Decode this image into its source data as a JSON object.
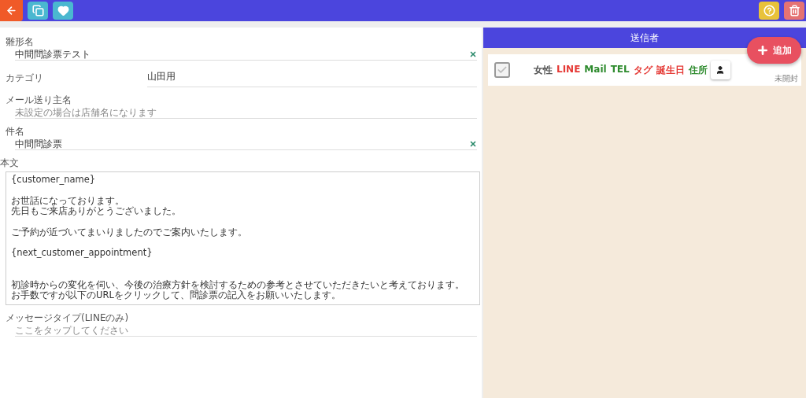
{
  "toolbar": {
    "left": [
      {
        "kind": "back"
      },
      {
        "kind": "copy"
      },
      {
        "kind": "favorite"
      }
    ],
    "right": [
      {
        "kind": "help"
      },
      {
        "kind": "delete"
      }
    ]
  },
  "form": {
    "fields": [
      {
        "kind": "text",
        "label": "雛形名",
        "value": "中間問診票テスト",
        "clearable": true
      },
      {
        "kind": "select",
        "label": "カテゴリ",
        "value": "山田用"
      },
      {
        "kind": "text",
        "label": "メール送り主名",
        "placeholder": "未設定の場合は店舗名になります"
      },
      {
        "kind": "text",
        "label": "件名",
        "value": "中間問診票",
        "clearable": true
      },
      {
        "kind": "textarea",
        "label": "本文",
        "paragraphs": [
          {
            "kind": "normal",
            "lines": [
              "{customer_name}"
            ]
          },
          {
            "kind": "normal",
            "lines": [
              "お世話になっております。",
              "先日もご来店ありがとうございました。"
            ]
          },
          {
            "kind": "normal",
            "lines": [
              "ご予約が近づいてまいりましたのでご案内いたします。"
            ]
          },
          {
            "kind": "normal",
            "lines": [
              "{next_customer_appointment}"
            ]
          },
          {
            "kind": "spaced",
            "lines": [
              "初診時からの変化を伺い、今後の治療方針を検討するための参考とさせていただきたいと考えております。",
              "お手数ですが以下のURLをクリックして、問診票の記入をお願いいたします。"
            ]
          }
        ]
      },
      {
        "kind": "text",
        "label": "メッセージタイプ(LINEのみ)",
        "placeholder": "ここをタップしてください"
      }
    ]
  },
  "senders": {
    "title": "送信者",
    "add_button": "追加",
    "items": [
      {
        "checked": true,
        "status": "未開封",
        "tags": [
          {
            "text": "女性",
            "color": "#555555"
          },
          {
            "text": "LINE",
            "color": "#e53935"
          },
          {
            "text": "Mail",
            "color": "#2e8b2e"
          },
          {
            "text": "TEL",
            "color": "#2e8b2e"
          },
          {
            "text": "タグ",
            "color": "#e53935"
          },
          {
            "text": "誕生日",
            "color": "#e53935"
          },
          {
            "text": "住所",
            "color": "#2e8b2e"
          }
        ]
      }
    ]
  }
}
